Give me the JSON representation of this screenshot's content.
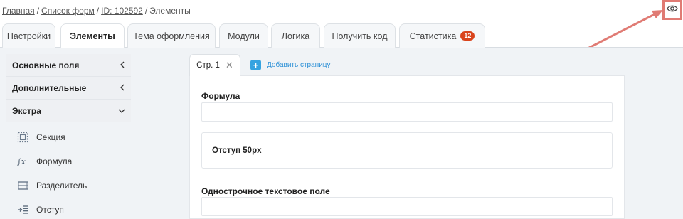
{
  "breadcrumb": {
    "items": [
      "Главная",
      "Список форм",
      "ID: 102592"
    ],
    "current": "Элементы",
    "separator": "/"
  },
  "tabs": [
    {
      "label": "Настройки"
    },
    {
      "label": "Элементы"
    },
    {
      "label": "Тема оформления"
    },
    {
      "label": "Модули"
    },
    {
      "label": "Логика"
    },
    {
      "label": "Получить код"
    },
    {
      "label": "Статистика",
      "badge": "12"
    }
  ],
  "active_tab": "Элементы",
  "sidebar": {
    "groups": [
      {
        "label": "Основные поля",
        "state": "collapsed"
      },
      {
        "label": "Дополнительные",
        "state": "collapsed"
      },
      {
        "label": "Экстра",
        "state": "expanded"
      }
    ],
    "elements": [
      {
        "label": "Секция",
        "icon": "section-icon"
      },
      {
        "label": "Формула",
        "icon": "formula-icon"
      },
      {
        "label": "Разделитель",
        "icon": "divider-icon"
      },
      {
        "label": "Отступ",
        "icon": "indent-icon"
      }
    ]
  },
  "pages": {
    "current_tab": "Стр. 1",
    "add_label": "Добавить страницу"
  },
  "form": {
    "formula_label": "Формула",
    "formula_value": "",
    "spacer_label": "Отступ 50px",
    "text_field_label": "Однострочное текстовое поле",
    "text_field_value": ""
  },
  "colors": {
    "accent_blue": "#35a3e0",
    "badge_red": "#d9441c",
    "highlight": "#e07b74"
  },
  "icons": {
    "preview": "eye-icon",
    "close_tab": "close-icon",
    "add_page": "plus-icon",
    "collapsed": "chevron-left-icon",
    "expanded": "chevron-down-icon"
  }
}
